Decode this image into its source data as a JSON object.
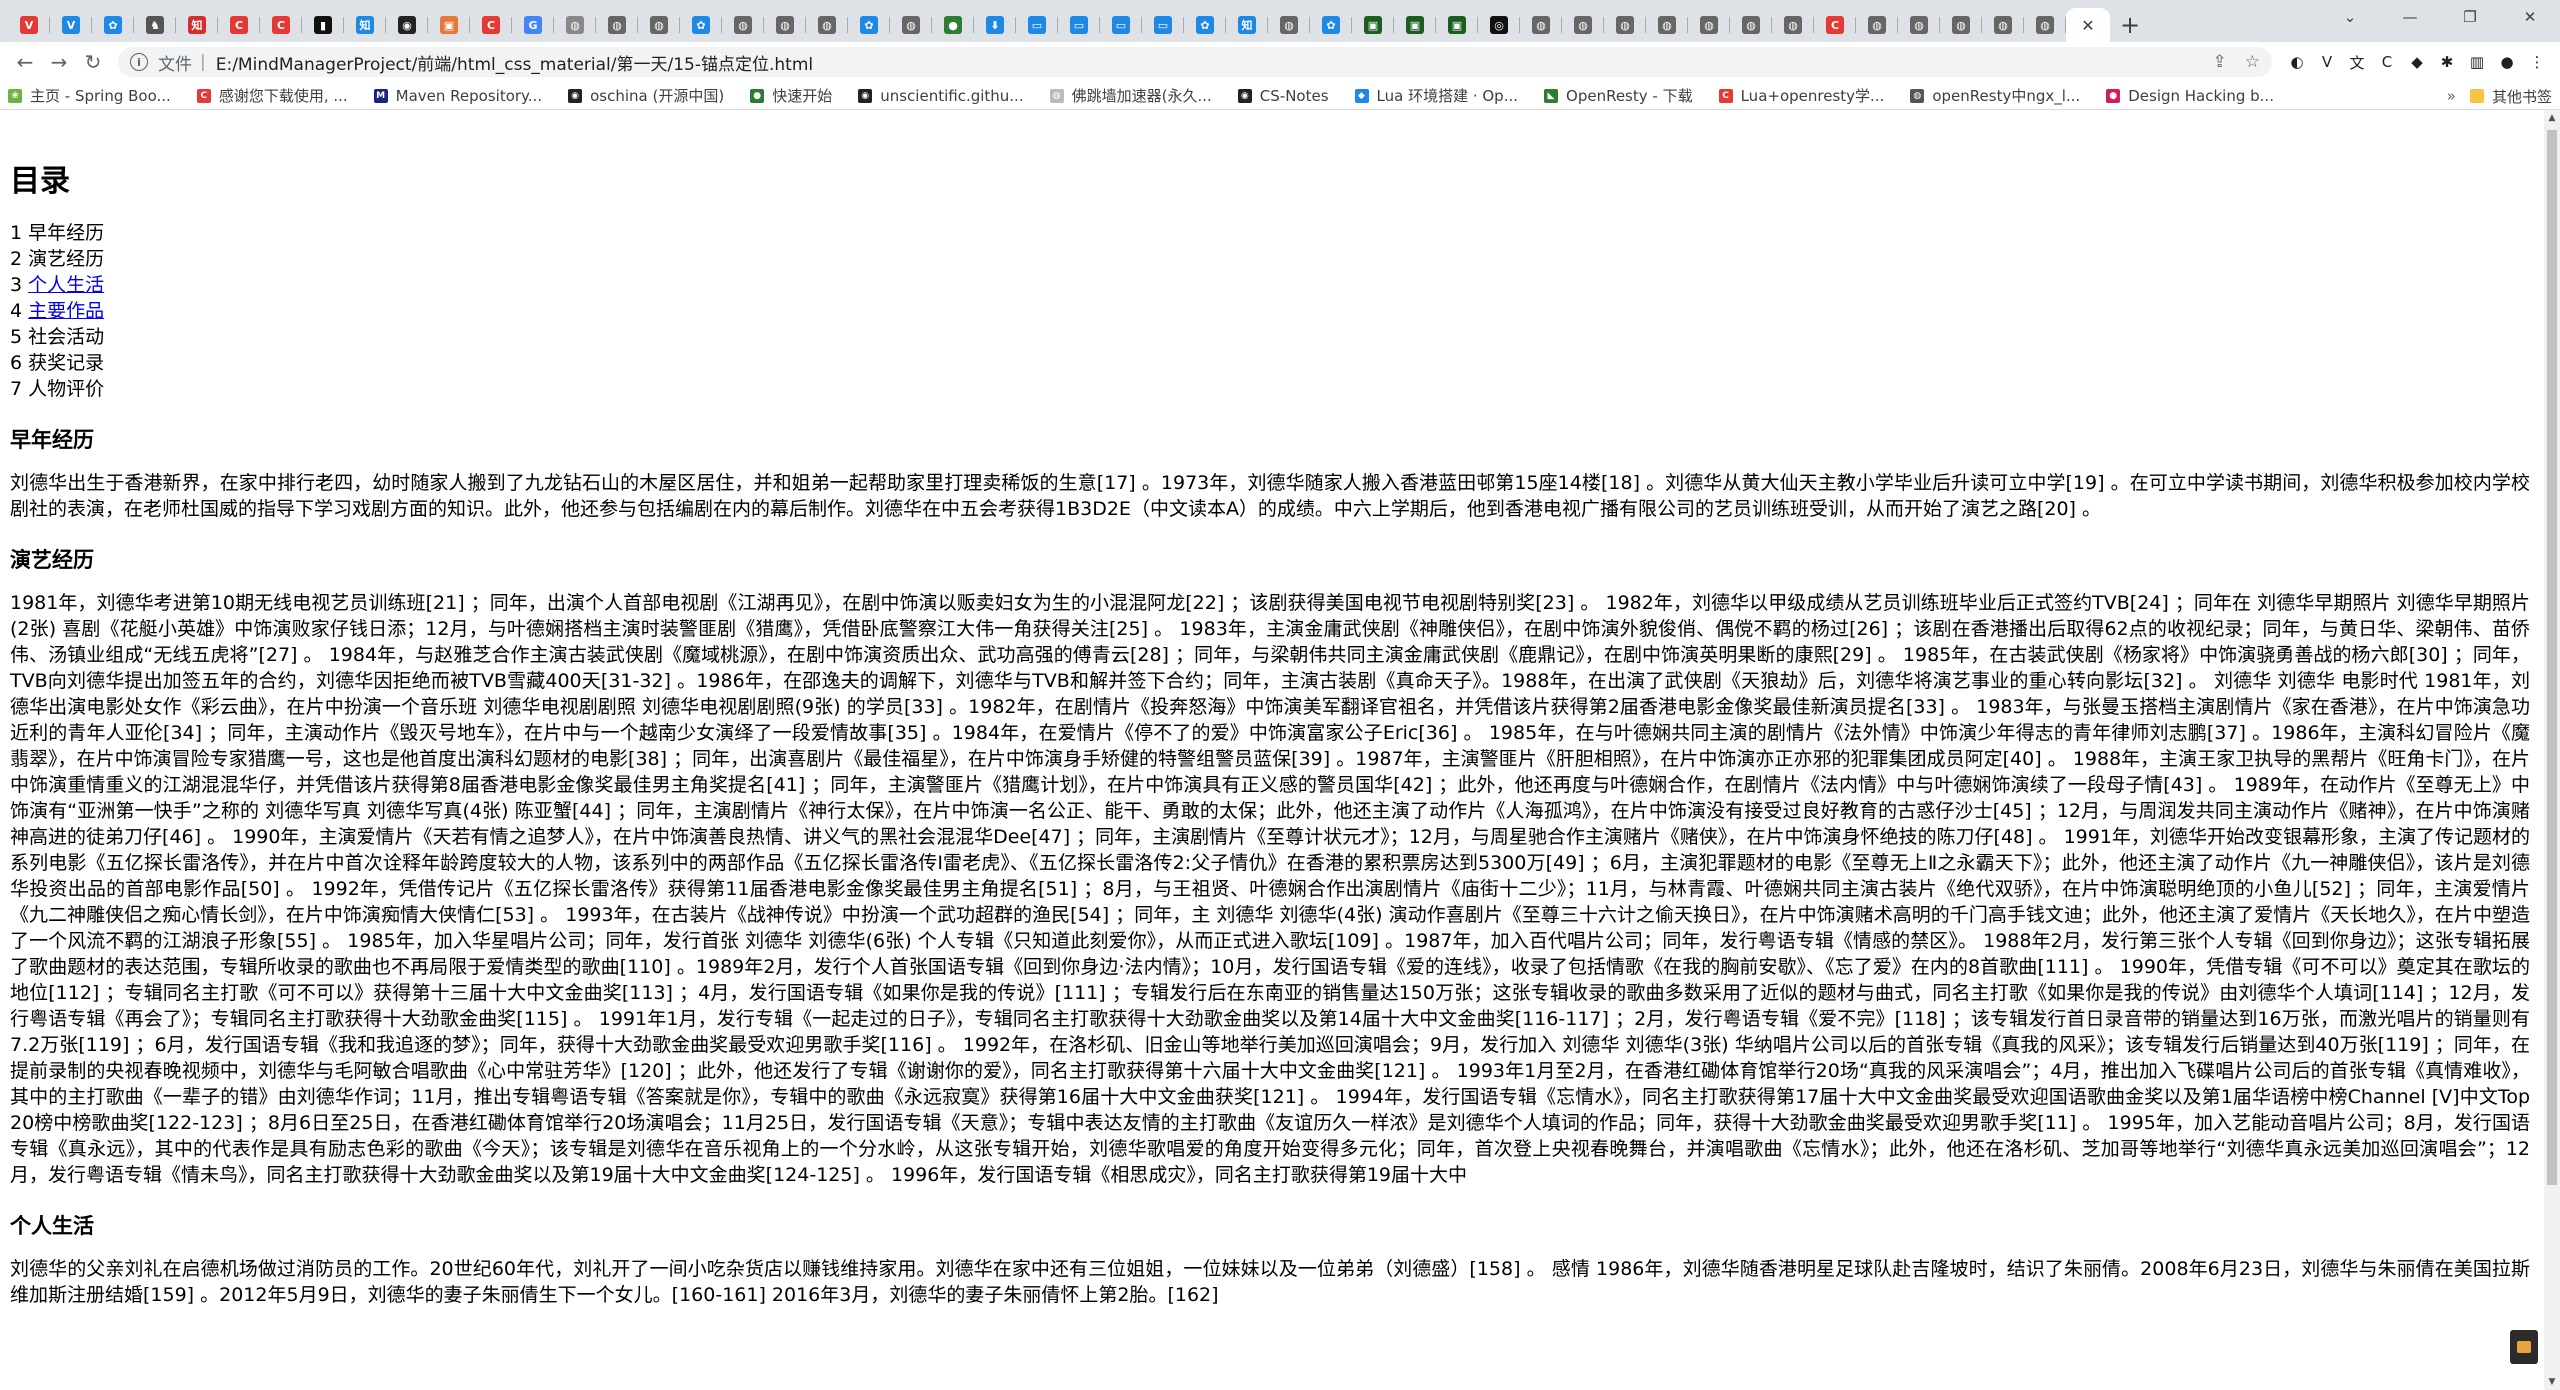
{
  "browser": {
    "tabs": [
      {
        "icon": "V",
        "color": "#e53935"
      },
      {
        "icon": "V",
        "color": "#1e88e5"
      },
      {
        "icon": "✿",
        "color": "#1e88e5"
      },
      {
        "icon": "♞",
        "color": "#555555"
      },
      {
        "icon": "知",
        "color": "#d32f2f"
      },
      {
        "icon": "C",
        "color": "#e53935"
      },
      {
        "icon": "C",
        "color": "#e53935"
      },
      {
        "icon": "▮",
        "color": "#111111"
      },
      {
        "icon": "知",
        "color": "#1e88e5"
      },
      {
        "icon": "◉",
        "color": "#222222"
      },
      {
        "icon": "▣",
        "color": "#e6783a"
      },
      {
        "icon": "C",
        "color": "#e53935"
      },
      {
        "icon": "G",
        "color": "#4285f4"
      },
      {
        "icon": "◍",
        "color": "#888888"
      },
      {
        "icon": "◍",
        "color": "#666666"
      },
      {
        "icon": "◍",
        "color": "#666666"
      },
      {
        "icon": "✿",
        "color": "#1e88e5"
      },
      {
        "icon": "◍",
        "color": "#666666"
      },
      {
        "icon": "◍",
        "color": "#666666"
      },
      {
        "icon": "◍",
        "color": "#666666"
      },
      {
        "icon": "✿",
        "color": "#1e88e5"
      },
      {
        "icon": "◍",
        "color": "#666666"
      },
      {
        "icon": "●",
        "color": "#2e7d32"
      },
      {
        "icon": "⬇",
        "color": "#1e88e5"
      },
      {
        "icon": "▭",
        "color": "#1e88e5"
      },
      {
        "icon": "▭",
        "color": "#1e88e5"
      },
      {
        "icon": "▭",
        "color": "#1e88e5"
      },
      {
        "icon": "▭",
        "color": "#1e88e5"
      },
      {
        "icon": "✿",
        "color": "#1e88e5"
      },
      {
        "icon": "知",
        "color": "#1e88e5"
      },
      {
        "icon": "◍",
        "color": "#666666"
      },
      {
        "icon": "✿",
        "color": "#1e88e5"
      },
      {
        "icon": "▣",
        "color": "#1b5e20"
      },
      {
        "icon": "▣",
        "color": "#1b5e20"
      },
      {
        "icon": "▣",
        "color": "#1b5e20"
      },
      {
        "icon": "◎",
        "color": "#111111"
      },
      {
        "icon": "◍",
        "color": "#666666"
      },
      {
        "icon": "◍",
        "color": "#666666"
      },
      {
        "icon": "◍",
        "color": "#666666"
      },
      {
        "icon": "◍",
        "color": "#666666"
      },
      {
        "icon": "◍",
        "color": "#666666"
      },
      {
        "icon": "◍",
        "color": "#666666"
      },
      {
        "icon": "◍",
        "color": "#666666"
      },
      {
        "icon": "C",
        "color": "#e53935"
      },
      {
        "icon": "◍",
        "color": "#666666"
      },
      {
        "icon": "◍",
        "color": "#666666"
      },
      {
        "icon": "◍",
        "color": "#666666"
      },
      {
        "icon": "◍",
        "color": "#666666"
      },
      {
        "icon": "◍",
        "color": "#666666"
      }
    ],
    "active_tab_close": "✕",
    "new_tab": "+",
    "window_controls": {
      "tab_search": "⌄",
      "minimize": "—",
      "maximize": "❐",
      "close": "✕"
    },
    "nav": {
      "back": "←",
      "forward": "→",
      "reload": "↻"
    },
    "address": {
      "info_icon": "i",
      "scheme_label": "文件",
      "separator": "|",
      "url": "E:/MindManagerProject/前端/html_css_material/第一天/15-锚点定位.html",
      "share_icon": "⇪",
      "star_icon": "☆"
    },
    "extensions": [
      "◐",
      "V",
      "文",
      "C",
      "◆",
      "✱",
      "▥",
      "●",
      "⋮"
    ],
    "bookmarks": [
      {
        "label": "主页 - Spring Boo...",
        "icon": "❀",
        "color": "#6db33f"
      },
      {
        "label": "感谢您下载使用, ...",
        "icon": "C",
        "color": "#e53935"
      },
      {
        "label": "Maven Repository...",
        "icon": "M",
        "color": "#1a237e"
      },
      {
        "label": "oschina (开源中国)",
        "icon": "◉",
        "color": "#222222"
      },
      {
        "label": "快速开始",
        "icon": "●",
        "color": "#2e7d32"
      },
      {
        "label": "unscientific.githu...",
        "icon": "◉",
        "color": "#222222"
      },
      {
        "label": "佛跳墙加速器(永久...",
        "icon": "◍",
        "color": "#bbbbbb"
      },
      {
        "label": "CS-Notes",
        "icon": "◉",
        "color": "#222222"
      },
      {
        "label": "Lua 环境搭建 · Op...",
        "icon": "◆",
        "color": "#1e88e5"
      },
      {
        "label": "OpenResty - 下载",
        "icon": "◣",
        "color": "#2e7d32"
      },
      {
        "label": "Lua+openresty学...",
        "icon": "C",
        "color": "#e53935"
      },
      {
        "label": "openResty中ngx_l...",
        "icon": "◍",
        "color": "#555555"
      },
      {
        "label": "Design Hacking b...",
        "icon": "●",
        "color": "#d81b60"
      }
    ],
    "bookmarks_more": "»",
    "other_bookmarks": "其他书签"
  },
  "page": {
    "title": "目录",
    "toc": [
      {
        "num": "1",
        "label": "早年经历",
        "link": false
      },
      {
        "num": "2",
        "label": "演艺经历",
        "link": false
      },
      {
        "num": "3",
        "label": "个人生活",
        "link": true
      },
      {
        "num": "4",
        "label": "主要作品",
        "link": true
      },
      {
        "num": "5",
        "label": "社会活动",
        "link": false
      },
      {
        "num": "6",
        "label": "获奖记录",
        "link": false
      },
      {
        "num": "7",
        "label": "人物评价",
        "link": false
      }
    ],
    "sections": [
      {
        "heading": "早年经历",
        "text": "刘德华出生于香港新界，在家中排行老四，幼时随家人搬到了九龙钻石山的木屋区居住，并和姐弟一起帮助家里打理卖稀饭的生意[17] 。1973年，刘德华随家人搬入香港蓝田邨第15座14楼[18] 。刘德华从黄大仙天主教小学毕业后升读可立中学[19] 。在可立中学读书期间，刘德华积极参加校内学校剧社的表演，在老师杜国威的指导下学习戏剧方面的知识。此外，他还参与包括编剧在内的幕后制作。刘德华在中五会考获得1B3D2E（中文读本A）的成绩。中六上学期后，他到香港电视广播有限公司的艺员训练班受训，从而开始了演艺之路[20] 。"
      },
      {
        "heading": "演艺经历",
        "text": "1981年，刘德华考进第10期无线电视艺员训练班[21] ；同年，出演个人首部电视剧《江湖再见》，在剧中饰演以贩卖妇女为生的小混混阿龙[22] ；该剧获得美国电视节电视剧特别奖[23] 。 1982年，刘德华以甲级成绩从艺员训练班毕业后正式签约TVB[24] ；同年在 刘德华早期照片 刘德华早期照片(2张) 喜剧《花艇小英雄》中饰演败家仔钱日添；12月，与叶德娴搭档主演时装警匪剧《猎鹰》，凭借卧底警察江大伟一角获得关注[25] 。 1983年，主演金庸武侠剧《神雕侠侣》，在剧中饰演外貌俊俏、偶傥不羁的杨过[26] ；该剧在香港播出后取得62点的收视纪录；同年，与黄日华、梁朝伟、苗侨伟、汤镇业组成“无线五虎将”[27] 。 1984年，与赵雅芝合作主演古装武侠剧《魔域桃源》，在剧中饰演资质出众、武功高强的傅青云[28] ；同年，与梁朝伟共同主演金庸武侠剧《鹿鼎记》，在剧中饰演英明果断的康熙[29] 。 1985年，在古装武侠剧《杨家将》中饰演骁勇善战的杨六郎[30] ；同年，TVB向刘德华提出加签五年的合约，刘德华因拒绝而被TVB雪藏400天[31-32] 。1986年，在邵逸夫的调解下，刘德华与TVB和解并签下合约；同年，主演古装剧《真命天子》。1988年，在出演了武侠剧《天狼劫》后，刘德华将演艺事业的重心转向影坛[32] 。 刘德华 刘德华 电影时代 1981年，刘德华出演电影处女作《彩云曲》，在片中扮演一个音乐班 刘德华电视剧剧照 刘德华电视剧剧照(9张) 的学员[33] 。1982年，在剧情片《投奔怒海》中饰演美军翻译官祖名，并凭借该片获得第2届香港电影金像奖最佳新演员提名[33] 。 1983年，与张曼玉搭档主演剧情片《家在香港》，在片中饰演急功近利的青年人亚伦[34] ；同年，主演动作片《毁灭号地车》，在片中与一个越南少女演绎了一段爱情故事[35] 。1984年，在爱情片《停不了的爱》中饰演富家公子Eric[36] 。 1985年，在与叶德娴共同主演的剧情片《法外情》中饰演少年得志的青年律师刘志鹏[37] 。1986年，主演科幻冒险片《魔翡翠》，在片中饰演冒险专家猎鹰一号，这也是他首度出演科幻题材的电影[38] ；同年，出演喜剧片《最佳福星》，在片中饰演身手矫健的特警组警员蓝保[39] 。1987年，主演警匪片《肝胆相照》，在片中饰演亦正亦邪的犯罪集团成员阿定[40] 。 1988年，主演王家卫执导的黑帮片《旺角卡门》，在片中饰演重情重义的江湖混混华仔，并凭借该片获得第8届香港电影金像奖最佳男主角奖提名[41] ；同年，主演警匪片《猎鹰计划》，在片中饰演具有正义感的警员国华[42] ；此外，他还再度与叶德娴合作，在剧情片《法内情》中与叶德娴饰演续了一段母子情[43] 。 1989年，在动作片《至尊无上》中饰演有“亚洲第一快手”之称的 刘德华写真 刘德华写真(4张) 陈亚蟹[44] ；同年，主演剧情片《神行太保》，在片中饰演一名公正、能干、勇敢的太保；此外，他还主演了动作片《人海孤鸿》，在片中饰演没有接受过良好教育的古惑仔沙士[45] ；12月，与周润发共同主演动作片《赌神》，在片中饰演赌神高进的徒弟刀仔[46] 。 1990年，主演爱情片《天若有情之追梦人》，在片中饰演善良热情、讲义气的黑社会混混华Dee[47] ；同年，主演剧情片《至尊计状元才》；12月，与周星驰合作主演赌片《赌侠》，在片中饰演身怀绝技的陈刀仔[48] 。 1991年，刘德华开始改变银幕形象，主演了传记题材的系列电影《五亿探长雷洛传》，并在片中首次诠释年龄跨度较大的人物，该系列中的两部作品《五亿探长雷洛传Ⅰ雷老虎》、《五亿探长雷洛传2:父子情仇》在香港的累积票房达到5300万[49] ；6月，主演犯罪题材的电影《至尊无上Ⅱ之永霸天下》；此外，他还主演了动作片《九一神雕侠侣》，该片是刘德华投资出品的首部电影作品[50] 。 1992年，凭借传记片《五亿探长雷洛传》获得第11届香港电影金像奖最佳男主角提名[51] ；8月，与王祖贤、叶德娴合作出演剧情片《庙街十二少》；11月，与林青霞、叶德娴共同主演古装片《绝代双骄》，在片中饰演聪明绝顶的小鱼儿[52] ；同年，主演爱情片《九二神雕侠侣之痴心情长剑》，在片中饰演痴情大侠情仁[53] 。 1993年，在古装片《战神传说》中扮演一个武功超群的渔民[54] ；同年，主 刘德华 刘德华(4张) 演动作喜剧片《至尊三十六计之偷天换日》，在片中饰演赌术高明的千门高手钱文迪；此外，他还主演了爱情片《天长地久》，在片中塑造了一个风流不羁的江湖浪子形象[55] 。 1985年，加入华星唱片公司；同年，发行首张 刘德华 刘德华(6张) 个人专辑《只知道此刻爱你》，从而正式进入歌坛[109] 。1987年，加入百代唱片公司；同年，发行粤语专辑《情感的禁区》。 1988年2月，发行第三张个人专辑《回到你身边》；这张专辑拓展了歌曲题材的表达范围，专辑所收录的歌曲也不再局限于爱情类型的歌曲[110] 。1989年2月，发行个人首张国语专辑《回到你身边·法内情》；10月，发行国语专辑《爱的连线》，收录了包括情歌《在我的胸前安歇》、《忘了爱》在内的8首歌曲[111] 。 1990年，凭借专辑《可不可以》奠定其在歌坛的地位[112] ；专辑同名主打歌《可不可以》获得第十三届十大中文金曲奖[113] ；4月，发行国语专辑《如果你是我的传说》[111] ；专辑发行后在东南亚的销售量达150万张；这张专辑收录的歌曲多数采用了近似的题材与曲式，同名主打歌《如果你是我的传说》由刘德华个人填词[114] ；12月，发行粤语专辑《再会了》；专辑同名主打歌获得十大劲歌金曲奖[115] 。 1991年1月，发行专辑《一起走过的日子》，专辑同名主打歌获得十大劲歌金曲奖以及第14届十大中文金曲奖[116-117] ；2月，发行粤语专辑《爱不完》[118] ；该专辑发行首日录音带的销量达到16万张，而激光唱片的销量则有7.2万张[119] ；6月，发行国语专辑《我和我追逐的梦》；同年，获得十大劲歌金曲奖最受欢迎男歌手奖[116] 。 1992年，在洛杉矶、旧金山等地举行美加巡回演唱会；9月，发行加入 刘德华 刘德华(3张) 华纳唱片公司以后的首张专辑《真我的风采》；该专辑发行后销量达到40万张[119] ；同年，在提前录制的央视春晚视频中，刘德华与毛阿敏合唱歌曲《心中常驻芳华》[120] ；此外，他还发行了专辑《谢谢你的爱》，同名主打歌获得第十六届十大中文金曲奖[121] 。 1993年1月至2月，在香港红磡体育馆举行20场“真我的风采演唱会”；4月，推出加入飞碟唱片公司后的首张专辑《真情难收》，其中的主打歌曲《一辈子的错》由刘德华作词；11月，推出专辑粤语专辑《答案就是你》，专辑中的歌曲《永远寂寞》获得第16届十大中文金曲获奖[121] 。 1994年，发行国语专辑《忘情水》，同名主打歌获得第17届十大中文金曲奖最受欢迎国语歌曲金奖以及第1届华语榜中榜Channel [V]中文Top 20榜中榜歌曲奖[122-123] ；8月6日至25日，在香港红磡体育馆举行20场演唱会；11月25日，发行国语专辑《天意》；专辑中表达友情的主打歌曲《友谊历久一样浓》是刘德华个人填词的作品；同年，获得十大劲歌金曲奖最受欢迎男歌手奖[11] 。 1995年，加入艺能动音唱片公司；8月，发行国语专辑《真永远》，其中的代表作是具有励志色彩的歌曲《今天》；该专辑是刘德华在音乐视角上的一个分水岭，从这张专辑开始，刘德华歌唱爱的角度开始变得多元化；同年，首次登上央视春晚舞台，并演唱歌曲《忘情水》；此外，他还在洛杉矶、芝加哥等地举行“刘德华真永远美加巡回演唱会”；12月，发行粤语专辑《情未鸟》，同名主打歌获得十大劲歌金曲奖以及第19届十大中文金曲奖[124-125] 。 1996年，发行国语专辑《相思成灾》，同名主打歌获得第19届十大中"
      },
      {
        "heading": "个人生活",
        "text": "刘德华的父亲刘礼在启德机场做过消防员的工作。20世纪60年代，刘礼开了一间小吃杂货店以赚钱维持家用。刘德华在家中还有三位姐姐，一位妹妹以及一位弟弟（刘德盛）[158] 。 感情 1986年，刘德华随香港明星足球队赴吉隆坡时，结识了朱丽倩。2008年6月23日，刘德华与朱丽倩在美国拉斯维加斯注册结婚[159] 。2012年5月9日，刘德华的妻子朱丽倩生下一个女儿。[160-161] 2016年3月，刘德华的妻子朱丽倩怀上第2胎。[162]"
      }
    ]
  },
  "scrollbar": {
    "up": "▲",
    "down": "▼"
  }
}
